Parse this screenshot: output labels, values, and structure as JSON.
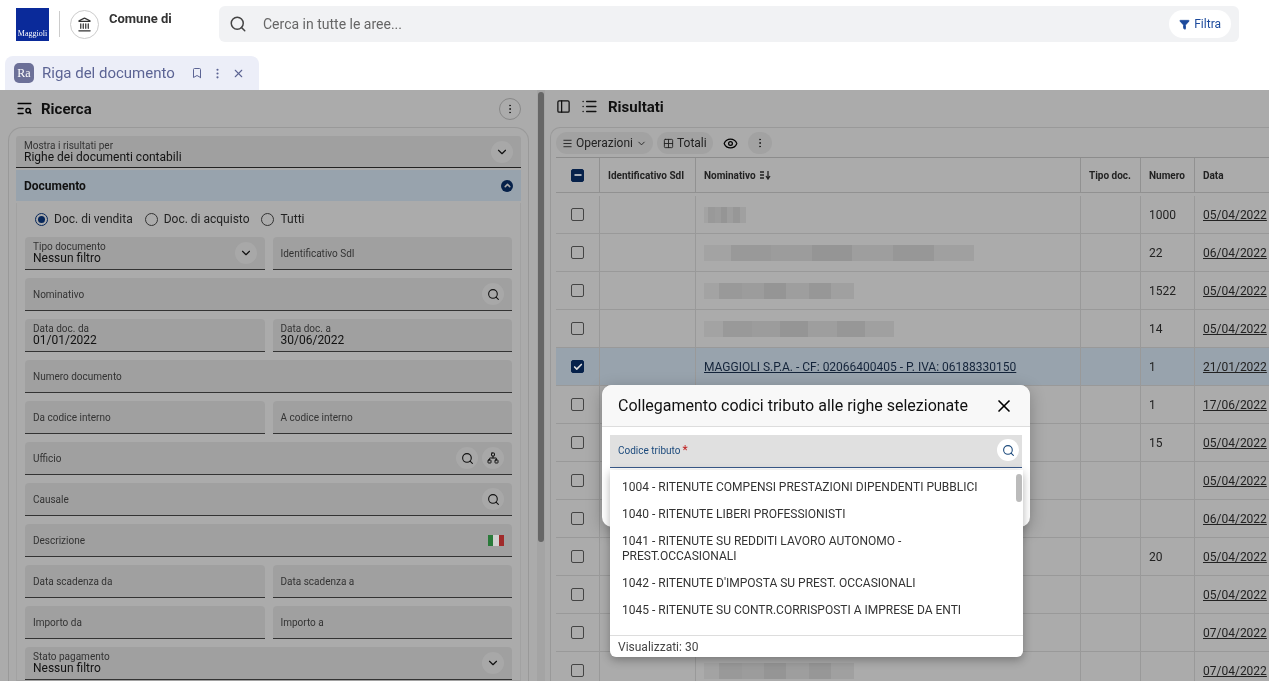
{
  "header": {
    "logo_text": "Maggioli",
    "org": "Comune di",
    "search": {
      "placeholder": "Cerca in tutte le aree..."
    },
    "filter_button": "Filtra"
  },
  "tab": {
    "badge": "Ra",
    "title": "Riga del documento",
    "selected": true
  },
  "search_panel": {
    "title": "Ricerca",
    "results_for": {
      "label": "Mostra i risultati per",
      "value": "Righe dei documenti contabili"
    },
    "section": {
      "title": "Documento",
      "expanded": true
    },
    "radios": [
      {
        "label": "Doc. di vendita",
        "selected": true
      },
      {
        "label": "Doc. di acquisto",
        "selected": false
      },
      {
        "label": "Tutti",
        "selected": false
      }
    ],
    "field_rows": [
      [
        {
          "kind": "select",
          "label": "Tipo documento",
          "value": "Nessun filtro"
        },
        {
          "kind": "text",
          "label": "Identificativo SdI"
        }
      ],
      [
        {
          "kind": "search",
          "label": "Nominativo"
        }
      ],
      [
        {
          "kind": "text",
          "label": "Data doc. da",
          "value": "01/01/2022"
        },
        {
          "kind": "text",
          "label": "Data doc. a",
          "value": "30/06/2022"
        }
      ],
      [
        {
          "kind": "text",
          "label": "Numero documento"
        }
      ],
      [
        {
          "kind": "text",
          "label": "Da codice interno"
        },
        {
          "kind": "text",
          "label": "A codice interno"
        }
      ],
      [
        {
          "kind": "search-tree",
          "label": "Ufficio"
        }
      ],
      [
        {
          "kind": "search",
          "label": "Causale"
        }
      ],
      [
        {
          "kind": "translatable",
          "label": "Descrizione"
        }
      ],
      [
        {
          "kind": "text",
          "label": "Data scadenza da"
        },
        {
          "kind": "text",
          "label": "Data scadenza a"
        }
      ],
      [
        {
          "kind": "text",
          "label": "Importo da"
        },
        {
          "kind": "text",
          "label": "Importo a"
        }
      ],
      [
        {
          "kind": "select",
          "label": "Stato pagamento",
          "value": "Nessun filtro"
        }
      ]
    ]
  },
  "results_panel": {
    "title": "Risultati",
    "toolbar": {
      "operations": "Operazioni",
      "totals": "Totali"
    },
    "table": {
      "select_all": {
        "indeterminate": true
      },
      "columns": [
        "Identificativo SdI",
        "Nominativo",
        "Tipo doc.",
        "Numero",
        "Data"
      ],
      "rows": [
        {
          "selected": false,
          "nominativo": {
            "kind": "blurred"
          },
          "numero": "1000",
          "data": "05/04/2022"
        },
        {
          "selected": false,
          "nominativo": {
            "kind": "blurred"
          },
          "numero": "22",
          "data": "06/04/2022"
        },
        {
          "selected": false,
          "nominativo": {
            "kind": "blurred"
          },
          "numero": "1522",
          "data": "05/04/2022"
        },
        {
          "selected": false,
          "nominativo": {
            "kind": "blurred"
          },
          "numero": "14",
          "data": "05/04/2022"
        },
        {
          "selected": true,
          "nominativo": {
            "kind": "link",
            "text": "MAGGIOLI S.P.A. - CF: 02066400405 - P. IVA: 06188330150"
          },
          "numero": "1",
          "data": "21/01/2022"
        },
        {
          "selected": false,
          "numero": "1",
          "data": "17/06/2022"
        },
        {
          "selected": false,
          "numero": "15",
          "data": "05/04/2022"
        },
        {
          "selected": false,
          "data": "05/04/2022"
        },
        {
          "selected": false,
          "data": "06/04/2022"
        },
        {
          "selected": false,
          "numero": "20",
          "data": "05/04/2022"
        },
        {
          "selected": false,
          "data": "05/04/2022"
        },
        {
          "selected": false,
          "data": "07/04/2022"
        },
        {
          "selected": false,
          "nominativo": {
            "kind": "blurred"
          },
          "data": "07/04/2022"
        }
      ]
    }
  },
  "dialog": {
    "title": "Collegamento codici tributo alle righe selezionate",
    "field": {
      "label": "Codice tributo",
      "required_mark": "*"
    },
    "options": [
      "1004 - RITENUTE COMPENSI PRESTAZIONI DIPENDENTI PUBBLICI",
      "1040 - RITENUTE LIBERI PROFESSIONISTI",
      "1041 - RITENUTE SU REDDITI LAVORO AUTONOMO - PREST.OCCASIONALI",
      "1042 - RITENUTE D'IMPOSTA SU PREST. OCCASIONALI",
      "1045 - RITENUTE SU CONTR.CORRISPOSTI A IMPRESE DA ENTI"
    ],
    "footer": "Visualizzati: 30"
  }
}
